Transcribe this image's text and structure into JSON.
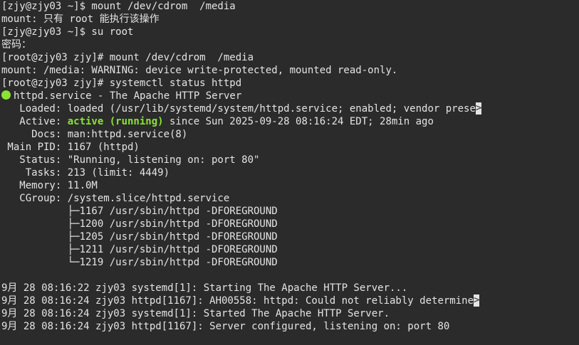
{
  "terminal": {
    "lines": {
      "l0": "[zjy@zjy03 ~]$ mount /dev/cdrom  /media",
      "l1": "mount: 只有 root 能执行该操作",
      "l2": "[zjy@zjy03 ~]$ su root",
      "l3": "密码：",
      "l4": "[root@zjy03 zjy]# mount /dev/cdrom  /media",
      "l5": "mount: /media: WARNING: device write-protected, mounted read-only.",
      "l6": "[root@zjy03 zjy]# systemctl status httpd",
      "l7": "httpd.service - The Apache HTTP Server",
      "l8": "   Loaded: loaded (/usr/lib/systemd/system/httpd.service; enabled; vendor prese",
      "l9_prefix": "   Active: ",
      "l9_status": "active (running)",
      "l9_suffix": " since Sun 2025-09-28 08:16:24 EDT; 28min ago",
      "l10": "     Docs: man:httpd.service(8)",
      "l11": " Main PID: 1167 (httpd)",
      "l12": "   Status: \"Running, listening on: port 80\"",
      "l13": "    Tasks: 213 (limit: 4449)",
      "l14": "   Memory: 11.0M",
      "l15": "   CGroup: /system.slice/httpd.service",
      "l16": "           ├─1167 /usr/sbin/httpd -DFOREGROUND",
      "l17": "           ├─1200 /usr/sbin/httpd -DFOREGROUND",
      "l18": "           ├─1205 /usr/sbin/httpd -DFOREGROUND",
      "l19": "           ├─1211 /usr/sbin/httpd -DFOREGROUND",
      "l20": "           └─1219 /usr/sbin/httpd -DFOREGROUND",
      "l22": "9月 28 08:16:22 zjy03 systemd[1]: Starting The Apache HTTP Server...",
      "l23": "9月 28 08:16:24 zjy03 httpd[1167]: AH00558: httpd: Could not reliably determine",
      "l24": "9月 28 08:16:24 zjy03 systemd[1]: Started The Apache HTTP Server.",
      "l25": "9月 28 08:16:24 zjy03 httpd[1167]: Server configured, listening on: port 80"
    },
    "trunc_glyph": ">",
    "colors": {
      "background": "#2b2b2b",
      "foreground": "#e4e4e4",
      "active": "#8ae234"
    },
    "icons": {
      "status_dot": "green-circle-icon"
    }
  }
}
